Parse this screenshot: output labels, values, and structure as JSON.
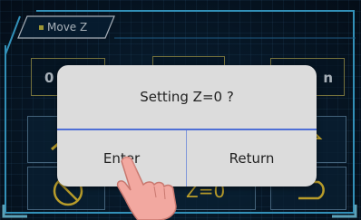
{
  "tab": {
    "label": "Move Z"
  },
  "background": {
    "left_box": "0",
    "right_box": "n",
    "bottom_label": "Z=0"
  },
  "dialog": {
    "message": "Setting Z=0 ?",
    "enter_label": "Enter",
    "return_label": "Return"
  },
  "colors": {
    "accent_yellow": "#ffd93b",
    "frame_cyan": "#46c8ff",
    "dialog_bg": "#dcdcdc",
    "divider_blue": "#4f6fd6"
  }
}
